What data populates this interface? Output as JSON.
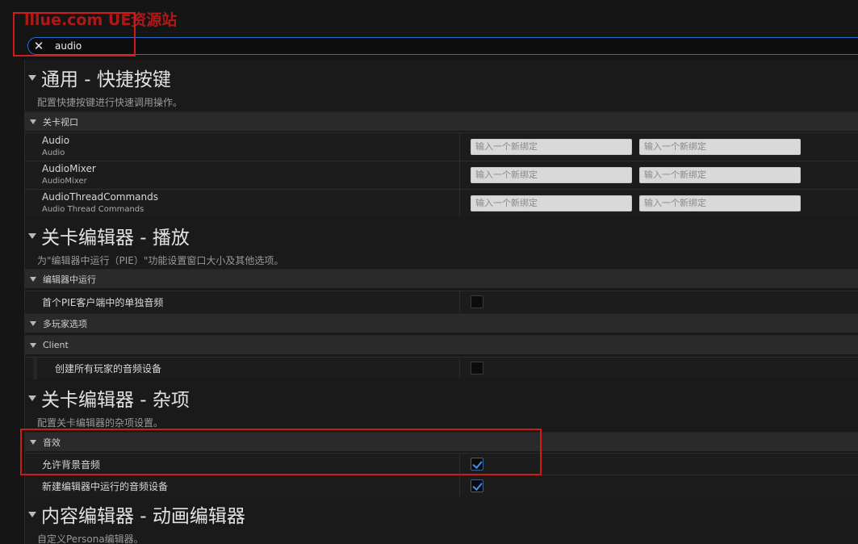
{
  "watermark": "lllue.com  UE资源站",
  "search": {
    "value": "audio"
  },
  "sections": {
    "general": {
      "title": "通用 - 快捷按键",
      "desc": "配置快捷按键进行快速调用操作。",
      "category": "关卡视口",
      "rows": [
        {
          "name": "Audio",
          "sub": "Audio"
        },
        {
          "name": "AudioMixer",
          "sub": "AudioMixer"
        },
        {
          "name": "AudioThreadCommands",
          "sub": "Audio Thread Commands"
        }
      ],
      "binding_placeholder": "输入一个新绑定"
    },
    "play": {
      "title": "关卡编辑器 - 播放",
      "desc": "为\"编辑器中运行（PIE）\"功能设置窗口大小及其他选项。",
      "category_pie": "编辑器中运行",
      "row_pie": "首个PIE客户端中的单独音频",
      "category_multi": "多玩家选项",
      "category_client": "Client",
      "row_client": "创建所有玩家的音频设备"
    },
    "misc": {
      "title": "关卡编辑器 - 杂项",
      "desc": "配置关卡编辑器的杂项设置。",
      "category": "音效",
      "row_bg": "允许背景音频",
      "row_new": "新建编辑器中运行的音频设备"
    },
    "content": {
      "title": "内容编辑器 - 动画编辑器",
      "desc": "自定义Persona编辑器。"
    }
  },
  "checkboxes": {
    "pie_separate_audio": false,
    "create_audio_all_players": false,
    "allow_background_audio": true,
    "new_pie_audio_device": true
  },
  "colors": {
    "accent": "#3f8ef2",
    "highlight": "#d11b1b"
  }
}
